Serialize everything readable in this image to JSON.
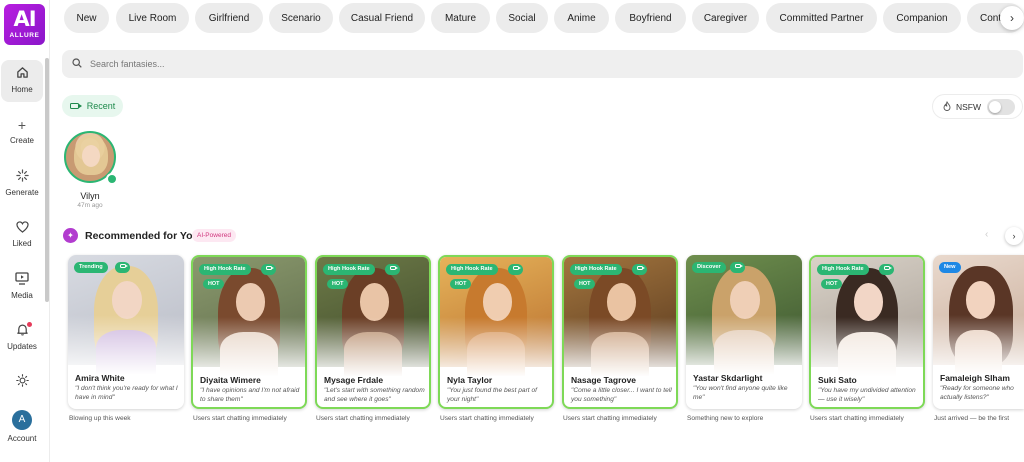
{
  "brand": {
    "logo_top": "AI",
    "logo_bottom": "ALLURE"
  },
  "sidebar": {
    "items": [
      {
        "label": "Home",
        "icon": "home-icon",
        "active": true
      },
      {
        "label": "Create",
        "icon": "plus-icon",
        "active": false
      },
      {
        "label": "Generate",
        "icon": "spinner-icon",
        "active": false
      },
      {
        "label": "Liked",
        "icon": "heart-icon",
        "active": false
      },
      {
        "label": "Media",
        "icon": "monitor-play-icon",
        "active": false
      },
      {
        "label": "Updates",
        "icon": "bell-icon",
        "active": false
      },
      {
        "label": "",
        "icon": "sun-icon",
        "active": false
      },
      {
        "label": "Account",
        "icon": "avatar",
        "active": false
      }
    ],
    "avatar_initial": "A"
  },
  "categories": [
    "New",
    "Live Room",
    "Girlfriend",
    "Scenario",
    "Casual Friend",
    "Mature",
    "Social",
    "Anime",
    "Boyfriend",
    "Caregiver",
    "Committed Partner",
    "Companion",
    "Cont"
  ],
  "search": {
    "placeholder": "Search fantasies..."
  },
  "recent": {
    "chip_label": "Recent",
    "name": "Vilyn",
    "time": "47m ago"
  },
  "nsfw": {
    "label": "NSFW",
    "enabled": false
  },
  "recommended": {
    "title": "Recommended for You",
    "badge": "AI-Powered",
    "cards": [
      {
        "name": "Amira White",
        "quote": "\"I don't think you're ready for what I have in mind\"",
        "tag": "Trending",
        "hot": false,
        "video": true,
        "highlight": false,
        "caption": "Blowing up this week"
      },
      {
        "name": "Diyaita Wimere",
        "quote": "\"I have opinions and I'm not afraid to share them\"",
        "tag": "High Hook Rate",
        "hot": true,
        "video": true,
        "highlight": true,
        "caption": "Users start chatting immediately"
      },
      {
        "name": "Mysage Frdale",
        "quote": "\"Let's start with something random and see where it goes\"",
        "tag": "High Hook Rate",
        "hot": true,
        "video": true,
        "highlight": true,
        "caption": "Users start chatting immediately"
      },
      {
        "name": "Nyla Taylor",
        "quote": "\"You just found the best part of your night\"",
        "tag": "High Hook Rate",
        "hot": true,
        "video": true,
        "highlight": true,
        "caption": "Users start chatting immediately"
      },
      {
        "name": "Nasage Tagrove",
        "quote": "\"Come a little closer... I want to tell you something\"",
        "tag": "High Hook Rate",
        "hot": true,
        "video": true,
        "highlight": true,
        "caption": "Users start chatting immediately"
      },
      {
        "name": "Yastar Skdarlight",
        "quote": "\"You won't find anyone quite like me\"",
        "tag": "Discover",
        "hot": false,
        "video": true,
        "highlight": false,
        "caption": "Something new to explore"
      },
      {
        "name": "Suki Sato",
        "quote": "\"You have my undivided attention — use it wisely\"",
        "tag": "High Hook Rate",
        "hot": true,
        "video": true,
        "highlight": true,
        "caption": "Users start chatting immediately"
      },
      {
        "name": "Famaleigh Slham",
        "quote": "\"Ready for someone who actually listens?\"",
        "tag": "New",
        "hot": false,
        "video": false,
        "highlight": false,
        "caption": "Just arrived — be the first"
      }
    ],
    "hot_label": "HOT"
  },
  "colors": {
    "accent_green": "#2bb673",
    "highlight_border": "#7ed957",
    "brand_purple": "#a21bd6",
    "new_blue": "#1e88e5"
  }
}
